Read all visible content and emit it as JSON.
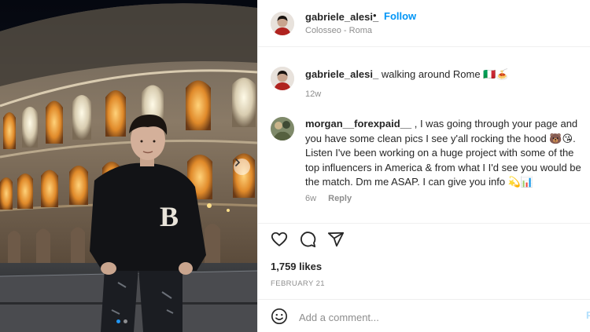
{
  "post": {
    "username": "gabriele_alesi_",
    "separator": "•",
    "follow_label": "Follow",
    "location": "Colosseo - Roma",
    "image_alt": "Man in black sweater with letter B in front of the illuminated Colosseum at night",
    "carousel": {
      "total_slides": 2,
      "active_index": 0
    }
  },
  "caption": {
    "username": "gabriele_alesi_",
    "text": "walking around Rome 🇮🇹🍝",
    "time": "12w"
  },
  "comments": [
    {
      "username": "morgan__forexpaid__",
      "text": ", I was going through your page and you have some clean pics I see y'all rocking the hood 🐻😘. Listen I've been working on a huge project with some of the top influencers in America & from what I I'd see you would be the match. Dm me ASAP. I can give you info 💫📊",
      "time": "6w",
      "reply_label": "Reply"
    }
  ],
  "actions": {
    "like_icon": "heart-outline-icon",
    "comment_icon": "comment-bubble-icon",
    "share_icon": "paper-plane-icon",
    "likes_text": "1,759 likes",
    "date_text": "FEBRUARY 21"
  },
  "add_comment": {
    "emoji_icon": "emoji-smile-icon",
    "placeholder": "Add a comment...",
    "post_label": "P"
  },
  "colors": {
    "accent": "#0095f6",
    "muted": "#8e8e8e",
    "text": "#262626",
    "carousel_active_dot": "#2196f3"
  }
}
